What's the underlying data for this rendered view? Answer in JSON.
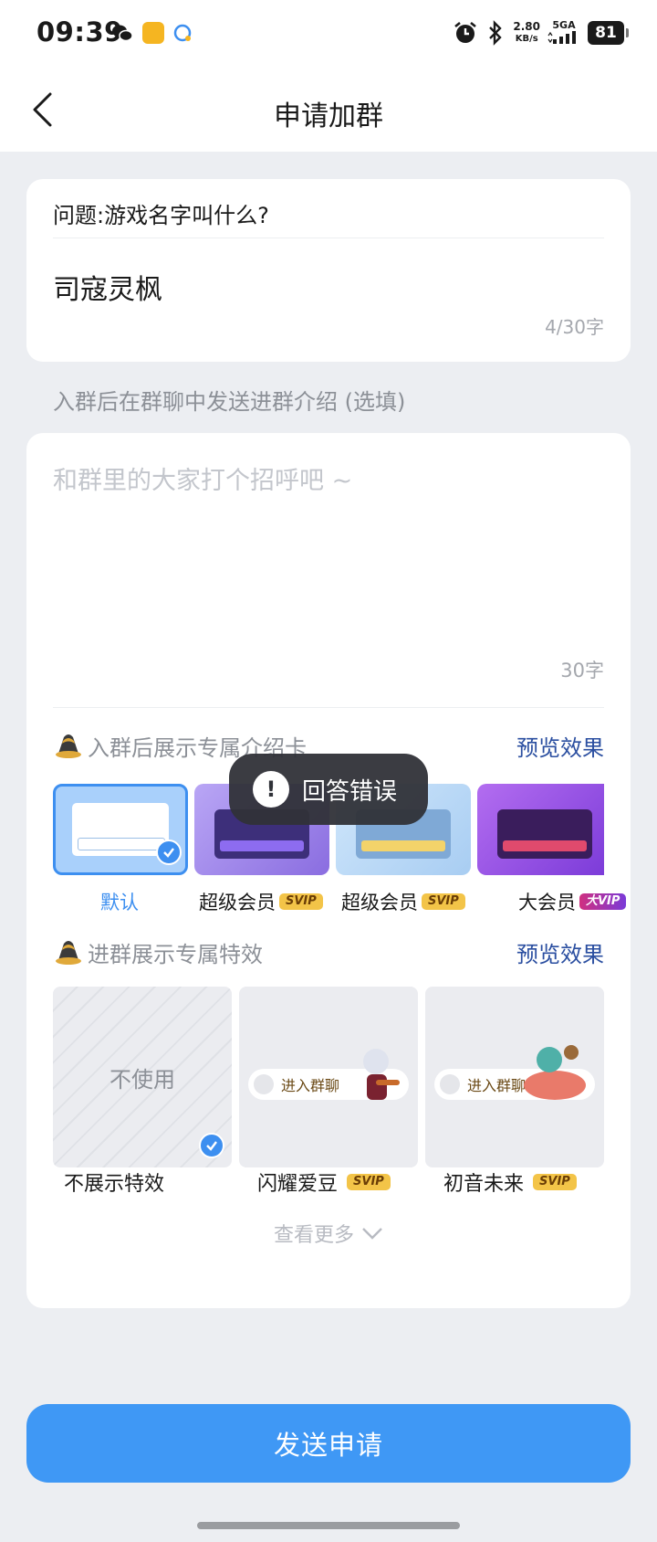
{
  "status_bar": {
    "time": "09:39",
    "net_speed_value": "2.80",
    "net_speed_unit": "KB/s",
    "signal": "5GA",
    "battery": "81"
  },
  "nav": {
    "title": "申请加群"
  },
  "question": {
    "prompt": "问题:游戏名字叫什么?",
    "answer": "司寇灵枫",
    "count": "4/30字"
  },
  "intro": {
    "label": "入群后在群聊中发送进群介绍 (选填)",
    "placeholder": "和群里的大家打个招呼吧 ~",
    "count": "30字"
  },
  "intro_card_section": {
    "title": "入群后展示专属介绍卡",
    "preview": "预览效果",
    "items": [
      {
        "label": "默认",
        "badge": "",
        "selected": true
      },
      {
        "label": "超级会员",
        "badge": "SVIP",
        "selected": false
      },
      {
        "label": "超级会员",
        "badge": "SVIP",
        "selected": false
      },
      {
        "label": "大会员",
        "badge": "大VIP",
        "selected": false
      }
    ]
  },
  "effects_section": {
    "title": "进群展示专属特效",
    "preview": "预览效果",
    "none_text": "不使用",
    "pill_text": "进入群聊",
    "items": [
      {
        "label": "不展示特效",
        "badge": "",
        "selected": true
      },
      {
        "label": "闪耀爱豆",
        "badge": "SVIP",
        "selected": false
      },
      {
        "label": "初音未来",
        "badge": "SVIP",
        "selected": false
      }
    ]
  },
  "see_more": "查看更多",
  "submit": "发送申请",
  "toast": {
    "text": "回答错误",
    "icon": "exclamation-icon"
  },
  "colors": {
    "accent": "#3f98f5",
    "preview_link": "#2a4ea0",
    "check": "#3d8ff0",
    "svip_badge": "#f3c448"
  }
}
